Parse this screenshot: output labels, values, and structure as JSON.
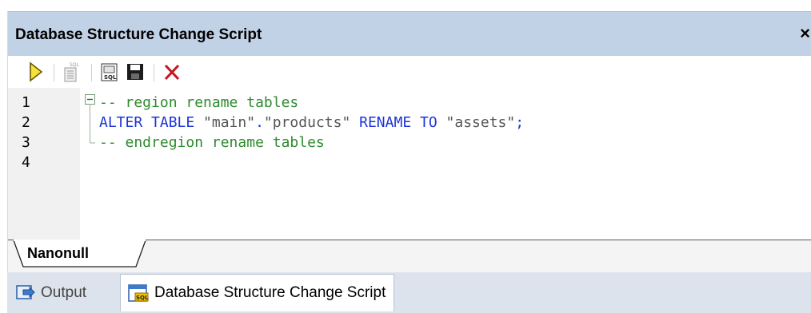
{
  "window": {
    "title": "Database Structure Change Script",
    "close_glyph": "×"
  },
  "toolbar": {
    "buttons": [
      {
        "name": "execute-script-button",
        "icon": "play-icon"
      },
      {
        "name": "open-sql-editor-button",
        "icon": "sql-editor-icon"
      },
      {
        "name": "open-sql-script-button",
        "icon": "sql-script-icon"
      },
      {
        "name": "save-script-button",
        "icon": "save-disk-icon"
      },
      {
        "name": "close-script-button",
        "icon": "red-x-icon"
      }
    ]
  },
  "editor": {
    "line_numbers": [
      "1",
      "2",
      "3",
      "4"
    ],
    "lines": [
      {
        "parts": [
          {
            "cls": "cmt",
            "text": "-- region rename tables"
          }
        ]
      },
      {
        "parts": [
          {
            "cls": "kw",
            "text": "ALTER TABLE "
          },
          {
            "cls": "str",
            "text": "\"main\""
          },
          {
            "cls": "kw",
            "text": "."
          },
          {
            "cls": "str",
            "text": "\"products\""
          },
          {
            "cls": "kw",
            "text": " RENAME TO "
          },
          {
            "cls": "str",
            "text": "\"assets\""
          },
          {
            "cls": "kw",
            "text": ";"
          }
        ]
      },
      {
        "parts": [
          {
            "cls": "cmt",
            "text": "-- endregion rename tables"
          }
        ]
      }
    ]
  },
  "db_tab": {
    "label": "Nanonull"
  },
  "bottom_tabs": [
    {
      "label": "Output",
      "icon": "output-icon",
      "active": false
    },
    {
      "label": "Database Structure Change Script",
      "icon": "sql-window-icon",
      "active": true
    }
  ],
  "colors": {
    "titlebar": "#c2d2e6",
    "comment": "#2e8b2e",
    "keyword": "#1d35d8",
    "string": "#555555"
  }
}
